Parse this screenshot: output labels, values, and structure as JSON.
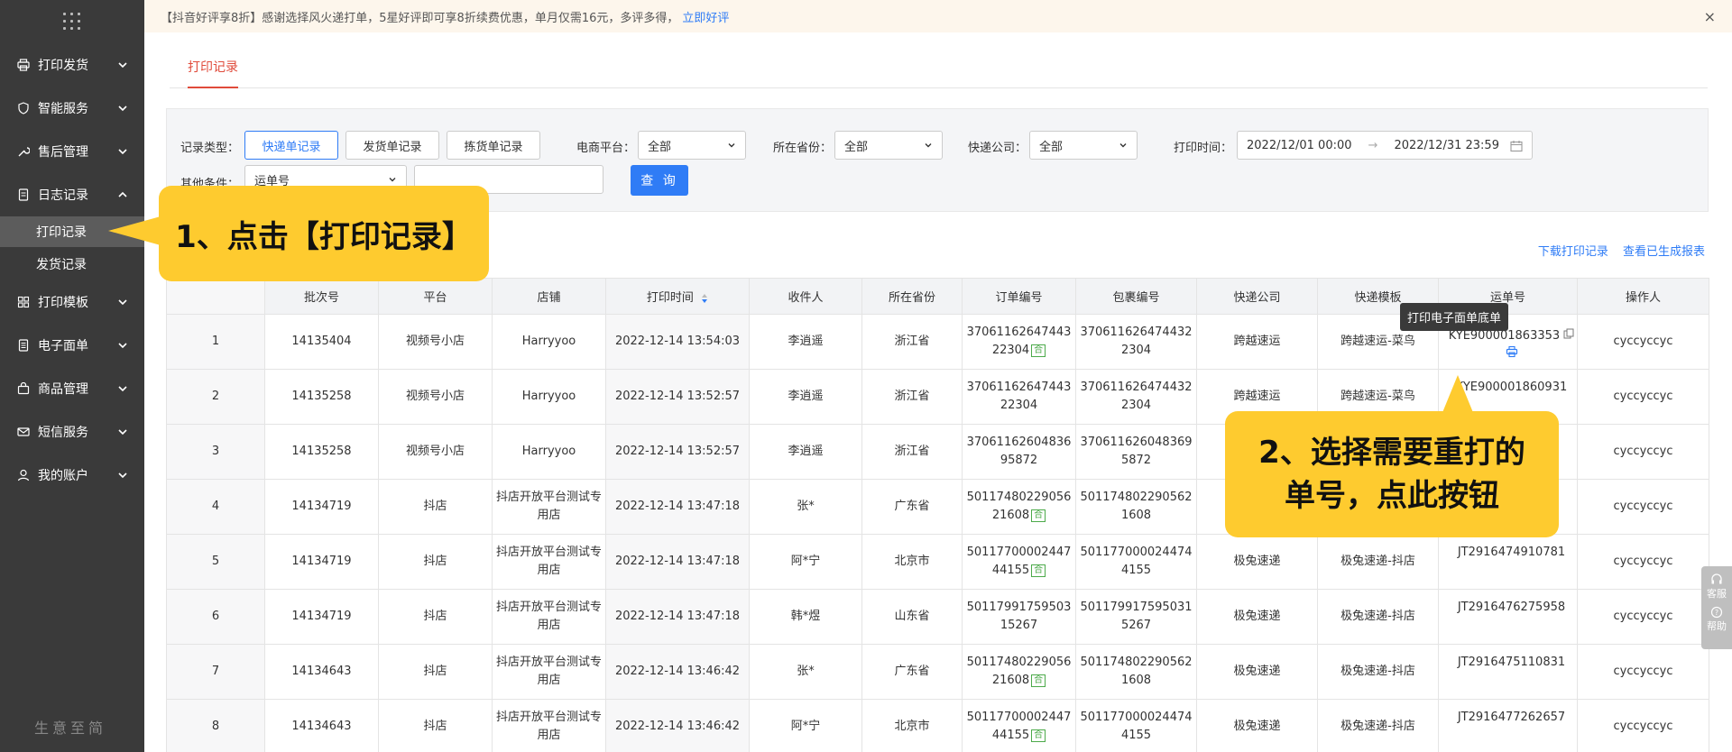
{
  "sidebar": {
    "items": [
      {
        "label": "打印发货",
        "icon": "printer-icon"
      },
      {
        "label": "智能服务",
        "icon": "shield-icon"
      },
      {
        "label": "售后管理",
        "icon": "wrench-icon"
      },
      {
        "label": "日志记录",
        "icon": "document-icon"
      },
      {
        "label": "打印模板",
        "icon": "grid-icon"
      },
      {
        "label": "电子面单",
        "icon": "list-icon"
      },
      {
        "label": "商品管理",
        "icon": "bag-icon"
      },
      {
        "label": "短信服务",
        "icon": "mail-icon"
      },
      {
        "label": "我的账户",
        "icon": "user-icon"
      }
    ],
    "subitems": [
      "打印记录",
      "发货记录"
    ],
    "footer": "生意至简"
  },
  "banner": {
    "text": "【抖音好评享8折】感谢选择风火递打单，5星好评即可享8折续费优惠，单月仅需16元，多评多得，",
    "link": "立即好评",
    "close": "×"
  },
  "tabs": {
    "active": "打印记录"
  },
  "filter": {
    "record_type_label": "记录类型：",
    "record_types": [
      "快递单记录",
      "发货单记录",
      "拣货单记录"
    ],
    "platform_label": "电商平台：",
    "platform_value": "全部",
    "province_label": "所在省份：",
    "province_value": "全部",
    "express_label": "快递公司：",
    "express_value": "全部",
    "time_label": "打印时间：",
    "time_start": "2022/12/01 00:00",
    "time_arrow": "→",
    "time_end": "2022/12/31 23:59",
    "other_label": "其他条件：",
    "other_value": "运单号",
    "query_button": "查 询"
  },
  "links": {
    "download": "下载打印记录",
    "view_reports": "查看已生成报表"
  },
  "table": {
    "headers": [
      "",
      "批次号",
      "平台",
      "店铺",
      "打印时间",
      "收件人",
      "所在省份",
      "订单编号",
      "包裹编号",
      "快递公司",
      "快递模板",
      "运单号",
      "操作人"
    ],
    "rows": [
      {
        "idx": "1",
        "batch": "14135404",
        "platform": "视频号小店",
        "shop": "Harryyoo",
        "time": "2022-12-14 13:54:03",
        "receiver": "李逍遥",
        "province": "浙江省",
        "order1": "37061162647443",
        "order2": "22304",
        "merged": true,
        "pkg1": "370611626474432",
        "pkg2": "2304",
        "express": "跨越速运",
        "template": "跨越速运-菜鸟",
        "waybill": "KYE900001863353",
        "operator": "cyccyccyc"
      },
      {
        "idx": "2",
        "batch": "14135258",
        "platform": "视频号小店",
        "shop": "Harryyoo",
        "time": "2022-12-14 13:52:57",
        "receiver": "李逍遥",
        "province": "浙江省",
        "order1": "37061162647443",
        "order2": "22304",
        "merged": false,
        "pkg1": "370611626474432",
        "pkg2": "2304",
        "express": "跨越速运",
        "template": "跨越速运-菜鸟",
        "waybill": "KYE900001860931",
        "operator": "cyccyccyc"
      },
      {
        "idx": "3",
        "batch": "14135258",
        "platform": "视频号小店",
        "shop": "Harryyoo",
        "time": "2022-12-14 13:52:57",
        "receiver": "李逍遥",
        "province": "浙江省",
        "order1": "37061162604836",
        "order2": "95872",
        "merged": false,
        "pkg1": "370611626048369",
        "pkg2": "5872",
        "express": "",
        "template": "",
        "waybill": "",
        "operator": "cyccyccyc"
      },
      {
        "idx": "4",
        "batch": "14134719",
        "platform": "抖店",
        "shop": "抖店开放平台测试专用店",
        "time": "2022-12-14 13:47:18",
        "receiver": "张*",
        "province": "广东省",
        "order1": "50117480229056",
        "order2": "21608",
        "merged": true,
        "pkg1": "501174802290562",
        "pkg2": "1608",
        "express": "",
        "template": "",
        "waybill": "",
        "operator": "cyccyccyc"
      },
      {
        "idx": "5",
        "batch": "14134719",
        "platform": "抖店",
        "shop": "抖店开放平台测试专用店",
        "time": "2022-12-14 13:47:18",
        "receiver": "阿*宁",
        "province": "北京市",
        "order1": "50117700002447",
        "order2": "44155",
        "merged": true,
        "pkg1": "501177000024474",
        "pkg2": "4155",
        "express": "极兔速递",
        "template": "极兔速递-抖店",
        "waybill": "JT2916474910781",
        "operator": "cyccyccyc"
      },
      {
        "idx": "6",
        "batch": "14134719",
        "platform": "抖店",
        "shop": "抖店开放平台测试专用店",
        "time": "2022-12-14 13:47:18",
        "receiver": "韩*煜",
        "province": "山东省",
        "order1": "50117991759503",
        "order2": "15267",
        "merged": false,
        "pkg1": "501179917595031",
        "pkg2": "5267",
        "express": "极兔速递",
        "template": "极兔速递-抖店",
        "waybill": "JT2916476275958",
        "operator": "cyccyccyc"
      },
      {
        "idx": "7",
        "batch": "14134643",
        "platform": "抖店",
        "shop": "抖店开放平台测试专用店",
        "time": "2022-12-14 13:46:42",
        "receiver": "张*",
        "province": "广东省",
        "order1": "50117480229056",
        "order2": "21608",
        "merged": true,
        "pkg1": "501174802290562",
        "pkg2": "1608",
        "express": "极兔速递",
        "template": "极兔速递-抖店",
        "waybill": "JT2916475110831",
        "operator": "cyccyccyc"
      },
      {
        "idx": "8",
        "batch": "14134643",
        "platform": "抖店",
        "shop": "抖店开放平台测试专用店",
        "time": "2022-12-14 13:46:42",
        "receiver": "阿*宁",
        "province": "北京市",
        "order1": "50117700002447",
        "order2": "44155",
        "merged": true,
        "pkg1": "501177000024474",
        "pkg2": "4155",
        "express": "极兔速递",
        "template": "极兔速递-抖店",
        "waybill": "JT2916477262657",
        "operator": "cyccyccyc"
      }
    ],
    "merge_badge": "合"
  },
  "tooltip": "打印电子面单底单",
  "callout1": "1、点击【打印记录】",
  "callout2_line1": "2、选择需要重打的",
  "callout2_line2": "单号，点此按钮",
  "side_help": {
    "service": "客服",
    "help": "帮助"
  },
  "colors": {
    "sidebar": "#3a3a3a",
    "accent_blue": "#2f7cf6",
    "tab_red": "#e04b3b",
    "callout": "#fecb2f",
    "banner_bg": "#fdf6ec"
  }
}
